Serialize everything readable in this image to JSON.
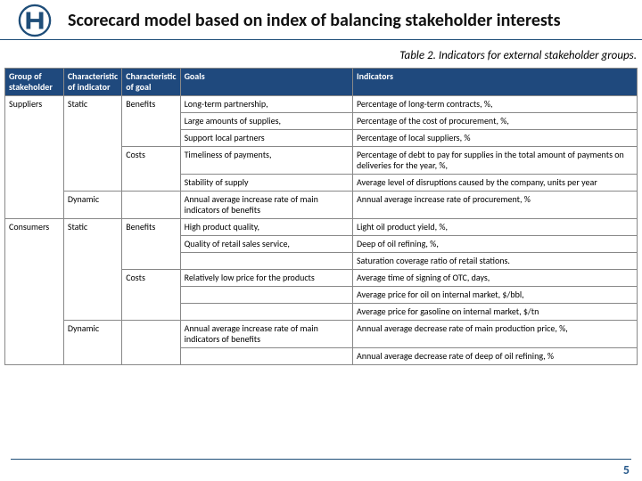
{
  "header": {
    "title": "Scorecard model based on index of balancing stakeholder interests"
  },
  "caption": "Table 2. Indicators for external stakeholder groups.",
  "columns": {
    "group": "Group of stakeholder",
    "char_ind": "Characteristic of indicator",
    "char_goal": "Characteristic of goal",
    "goals": "Goals",
    "indicators": "Indicators"
  },
  "groups": {
    "suppliers": "Suppliers",
    "consumers": "Consumers"
  },
  "char": {
    "static": "Static",
    "dynamic": "Dynamic"
  },
  "goalchar": {
    "benefits": "Benefits",
    "costs": "Costs"
  },
  "rows": {
    "r1": {
      "goal": "Long-term partnership,",
      "ind": "Percentage of long-term contracts, %,"
    },
    "r2": {
      "goal": "Large amounts of supplies,",
      "ind": "Percentage of the cost of procurement, %,"
    },
    "r3": {
      "goal": "Support local partners",
      "ind": "Percentage of local suppliers, %"
    },
    "r4": {
      "goal": "Timeliness of payments,",
      "ind": "Percentage of debt to pay for supplies in the total amount of payments on deliveries for the year, %,"
    },
    "r5": {
      "goal": "Stability of supply",
      "ind": "Average level of disruptions caused by the company, units per year"
    },
    "r6": {
      "goal": "Annual average increase rate of main indicators of benefits",
      "ind": "Annual average increase rate of procurement, %"
    },
    "r7": {
      "goal": "High product quality,",
      "ind": "Light oil product yield, %,"
    },
    "r8": {
      "goal": "Quality of retail sales service,",
      "ind": "Deep of oil refining, %,"
    },
    "r9": {
      "goal": "",
      "ind": "Saturation coverage ratio of retail stations."
    },
    "r10": {
      "goal": "Relatively low price for the products",
      "ind": "Average time of signing of OTC, days,"
    },
    "r11": {
      "goal": "",
      "ind": "Average price for oil on internal market, $/bbl,"
    },
    "r12": {
      "goal": "",
      "ind": "Average price for gasoline on internal market, $/tn"
    },
    "r13": {
      "goal": "Annual average increase rate of main indicators of benefits",
      "ind": "Annual average decrease rate of main production price, %,"
    },
    "r14": {
      "goal": "",
      "ind": "Annual average decrease rate of deep of oil refining, %"
    }
  },
  "page_number": "5",
  "chart_data": {
    "type": "table",
    "title": "Table 2. Indicators for external stakeholder groups.",
    "columns": [
      "Group of stakeholder",
      "Characteristic of indicator",
      "Characteristic of goal",
      "Goals",
      "Indicators"
    ],
    "rows": [
      [
        "Suppliers",
        "Static",
        "Benefits",
        "Long-term partnership,",
        "Percentage of long-term contracts, %,"
      ],
      [
        "Suppliers",
        "Static",
        "Benefits",
        "Large amounts of supplies,",
        "Percentage of the cost of procurement, %,"
      ],
      [
        "Suppliers",
        "Static",
        "Benefits",
        "Support local partners",
        "Percentage of local suppliers, %"
      ],
      [
        "Suppliers",
        "Static",
        "Costs",
        "Timeliness of payments,",
        "Percentage of debt to pay for supplies in the total amount of payments on deliveries for the year, %,"
      ],
      [
        "Suppliers",
        "Static",
        "Costs",
        "Stability of supply",
        "Average level of disruptions caused by the company, units per year"
      ],
      [
        "Suppliers",
        "Dynamic",
        "",
        "Annual average increase rate of main indicators of benefits",
        "Annual average increase rate of procurement, %"
      ],
      [
        "Consumers",
        "Static",
        "Benefits",
        "High product quality,",
        "Light oil product yield, %,"
      ],
      [
        "Consumers",
        "Static",
        "Benefits",
        "Quality of retail sales service,",
        "Deep of oil refining, %,"
      ],
      [
        "Consumers",
        "Static",
        "Benefits",
        "",
        "Saturation coverage ratio of retail stations."
      ],
      [
        "Consumers",
        "Static",
        "Costs",
        "Relatively low price for the products",
        "Average time of signing of OTC, days,"
      ],
      [
        "Consumers",
        "Static",
        "Costs",
        "",
        "Average price for oil on internal market, $/bbl,"
      ],
      [
        "Consumers",
        "Static",
        "Costs",
        "",
        "Average price for gasoline on internal market, $/tn"
      ],
      [
        "Consumers",
        "Dynamic",
        "",
        "Annual average increase rate of main indicators of benefits",
        "Annual average decrease rate of main production price, %,"
      ],
      [
        "Consumers",
        "Dynamic",
        "",
        "",
        "Annual average decrease rate of deep of oil refining, %"
      ]
    ]
  }
}
